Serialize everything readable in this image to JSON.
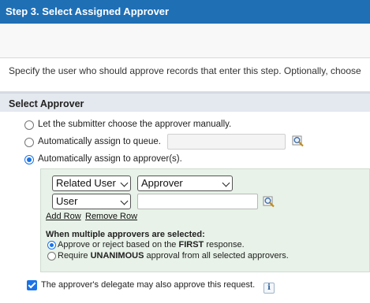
{
  "header": {
    "title": "Step 3. Select Assigned Approver"
  },
  "description": "Specify the user who should approve records that enter this step. Optionally, choose",
  "section": {
    "title": "Select Approver"
  },
  "options": {
    "manual": "Let the submitter choose the approver manually.",
    "queue": "Automatically assign to queue.",
    "approvers": "Automatically assign to approver(s)."
  },
  "queue_input": {
    "value": ""
  },
  "approver_rows": [
    {
      "type": "Related User",
      "field": "Approver"
    },
    {
      "type": "User",
      "value": ""
    }
  ],
  "links": {
    "add_row": "Add Row",
    "remove_row": "Remove Row"
  },
  "multiple": {
    "heading": "When multiple approvers are selected:",
    "first_prefix": "Approve or reject based on the ",
    "first_bold": "FIRST",
    "first_suffix": " response.",
    "unanimous_prefix": "Require ",
    "unanimous_bold": "UNANIMOUS",
    "unanimous_suffix": " approval from all selected approvers."
  },
  "delegate": {
    "label": "The approver's delegate may also approve this request.",
    "checked": true
  },
  "info_icon": "i",
  "colors": {
    "header": "#1f6fb5",
    "accent": "#1a73e8",
    "assign_box": "#e8f2e8"
  }
}
